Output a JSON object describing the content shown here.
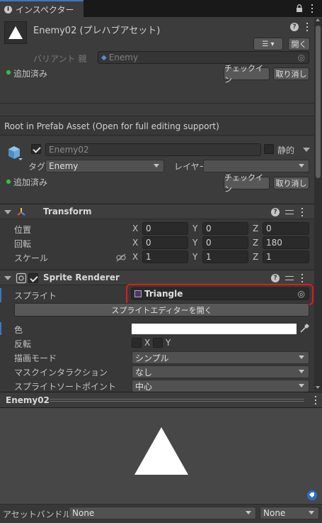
{
  "tab": {
    "title": "インスペクター"
  },
  "asset": {
    "name": "Enemy02 (プレハブアセット)",
    "open_label": "開く",
    "variant_label": "バリアント 親",
    "variant_value": "Enemy",
    "added_label": "追加済み",
    "checkin_label": "チェックイン",
    "revert_label": "取り消し"
  },
  "root_notice": "Root in Prefab Asset (Open for full editing support)",
  "gameobject": {
    "name": "Enemy02",
    "static_label": "静的",
    "tag_label": "タグ",
    "tag_value": "Enemy",
    "layer_label": "レイヤー",
    "layer_value": "",
    "added_label": "追加済み",
    "checkin_label": "チェックイン",
    "revert_label": "取り消し"
  },
  "transform": {
    "title": "Transform",
    "position": {
      "label": "位置",
      "x": "0",
      "y": "0",
      "z": "0"
    },
    "rotation": {
      "label": "回転",
      "x": "0",
      "y": "0",
      "z": "180"
    },
    "scale": {
      "label": "スケール",
      "x": "1",
      "y": "1",
      "z": "1"
    },
    "x": "X",
    "y": "Y",
    "z": "Z"
  },
  "sprite_renderer": {
    "title": "Sprite Renderer",
    "sprite_label": "スプライト",
    "sprite_value": "Triangle",
    "open_editor_label": "スプライトエディターを開く",
    "color_label": "色",
    "color_value": "#ffffff",
    "flip_label": "反転",
    "flip_x": "X",
    "flip_y": "Y",
    "draw_mode_label": "描画モード",
    "draw_mode_value": "シンプル",
    "mask_label": "マスクインタラクション",
    "mask_value": "なし",
    "sort_point_label": "スプライトソートポイント",
    "sort_point_value": "中心"
  },
  "preview": {
    "title": "Enemy02"
  },
  "bundle": {
    "label": "アセットバンドル",
    "value": "None",
    "variant": "None"
  },
  "colors": {
    "highlight": "#e01b1b",
    "accent": "#3a79bb"
  }
}
